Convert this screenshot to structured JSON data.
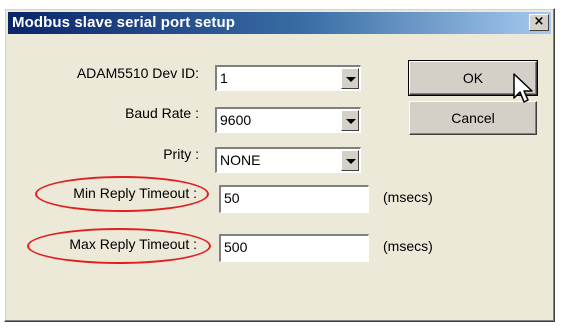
{
  "dialog": {
    "title": "Modbus slave serial port setup",
    "close_label": "×"
  },
  "form": {
    "dev_id": {
      "label": "ADAM5510 Dev ID:",
      "value": "1"
    },
    "baud_rate": {
      "label": "Baud Rate :",
      "value": "9600"
    },
    "parity": {
      "label": "Prity :",
      "value": "NONE"
    },
    "min_reply_timeout": {
      "label": "Min Reply Timeout :",
      "value": "50",
      "unit": "(msecs)"
    },
    "max_reply_timeout": {
      "label": "Max Reply Timeout :",
      "value": "500",
      "unit": "(msecs)"
    }
  },
  "buttons": {
    "ok_label": "OK",
    "cancel_label": "Cancel"
  },
  "annotation_color": "#e02020",
  "icons": [
    "close-icon",
    "dropdown-arrow-icon",
    "mouse-pointer-icon"
  ]
}
